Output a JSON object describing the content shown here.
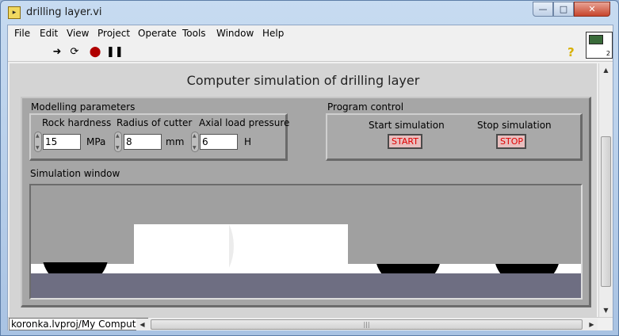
{
  "window": {
    "title": "drilling layer.vi"
  },
  "menu": [
    "File",
    "Edit",
    "View",
    "Project",
    "Operate",
    "Tools",
    "Window",
    "Help"
  ],
  "toolbar": {
    "icons": [
      "run-arrow-icon",
      "run-continuously-icon",
      "abort-icon",
      "pause-icon",
      "help-icon"
    ]
  },
  "vi_icon": {
    "number": "2"
  },
  "panel": {
    "title": "Computer simulation of drilling layer",
    "modelling": {
      "label": "Modelling parameters",
      "rock_hardness": {
        "label": "Rock hardness",
        "value": "15",
        "unit": "MPa"
      },
      "radius": {
        "label": "Radius of cutter",
        "value": "8",
        "unit": "mm"
      },
      "pressure": {
        "label": "Axial load pressure",
        "value": "6",
        "unit": "H"
      }
    },
    "program_control": {
      "label": "Program control",
      "start": {
        "label": "Start simulation",
        "button": "START"
      },
      "stop": {
        "label": "Stop simulation",
        "button": "STOP"
      }
    },
    "simulation": {
      "label": "Simulation window",
      "colors": {
        "rock": "#a0a0a0",
        "cavity": "#ffffff",
        "cutter": "#000000",
        "base": "#6e6e82"
      }
    }
  },
  "status": {
    "path": "koronka.lvproj/My Computer"
  }
}
